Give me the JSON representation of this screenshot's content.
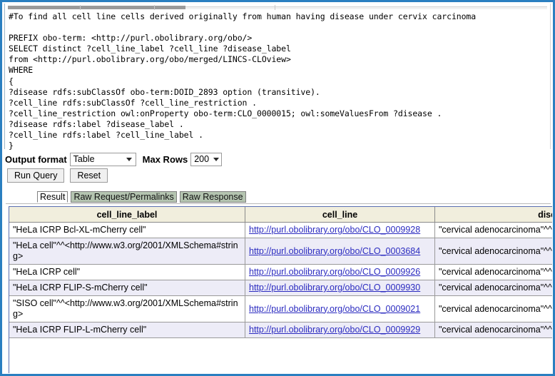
{
  "query": {
    "text": "#To find all cell line cells derived originally from human having disease under cervix carcinoma\n\nPREFIX obo-term: <http://purl.obolibrary.org/obo/>\nSELECT distinct ?cell_line_label ?cell_line ?disease_label\nfrom <http://purl.obolibrary.org/obo/merged/LINCS-CLOview>\nWHERE\n{\n?disease rdfs:subClassOf obo-term:DOID_2893 option (transitive).\n?cell_line rdfs:subClassOf ?cell_line_restriction .\n?cell_line_restriction owl:onProperty obo-term:CLO_0000015; owl:someValuesFrom ?disease .\n?disease rdfs:label ?disease_label .\n?cell_line rdfs:label ?cell_line_label .\n}"
  },
  "controls": {
    "output_format_label": "Output format",
    "output_format_value": "Table",
    "max_rows_label": "Max Rows",
    "max_rows_value": "200",
    "run_query_label": "Run Query",
    "reset_label": "Reset"
  },
  "tabs": [
    {
      "label": "Result",
      "active": true
    },
    {
      "label": "Raw Request/Permalinks",
      "active": false
    },
    {
      "label": "Raw Response",
      "active": false
    }
  ],
  "results": {
    "columns": [
      "cell_line_label",
      "cell_line",
      "disease_"
    ],
    "rows": [
      {
        "cell_line_label": "\"HeLa ICRP Bcl-XL-mCherry cell\"",
        "cell_line": "http://purl.obolibrary.org/obo/CLO_0009928",
        "disease_label": "\"cervical adenocarcinoma\"^^<http://www.w"
      },
      {
        "cell_line_label": "\"HeLa cell\"^^<http://www.w3.org/2001/XMLSchema#string>",
        "cell_line": "http://purl.obolibrary.org/obo/CLO_0003684",
        "disease_label": "\"cervical adenocarcinoma\"^^<http://www.w"
      },
      {
        "cell_line_label": "\"HeLa ICRP cell\"",
        "cell_line": "http://purl.obolibrary.org/obo/CLO_0009926",
        "disease_label": "\"cervical adenocarcinoma\"^^<http://www.w"
      },
      {
        "cell_line_label": "\"HeLa ICRP FLIP-S-mCherry cell\"",
        "cell_line": "http://purl.obolibrary.org/obo/CLO_0009930",
        "disease_label": "\"cervical adenocarcinoma\"^^<http://www.w"
      },
      {
        "cell_line_label": "\"SISO cell\"^^<http://www.w3.org/2001/XMLSchema#string>",
        "cell_line": "http://purl.obolibrary.org/obo/CLO_0009021",
        "disease_label": "\"cervical adenocarcinoma\"^^<http://www.w"
      },
      {
        "cell_line_label": "\"HeLa ICRP FLIP-L-mCherry cell\"",
        "cell_line": "http://purl.obolibrary.org/obo/CLO_0009929",
        "disease_label": "\"cervical adenocarcinoma\"^^<http://www.w"
      }
    ]
  },
  "colors": {
    "window_border": "#2a7fc0",
    "table_header_bg": "#f1eedd",
    "row_alt_bg": "#edecf7",
    "link": "#2b2bc0",
    "tab_inactive_bg": "#b4c4b0"
  }
}
